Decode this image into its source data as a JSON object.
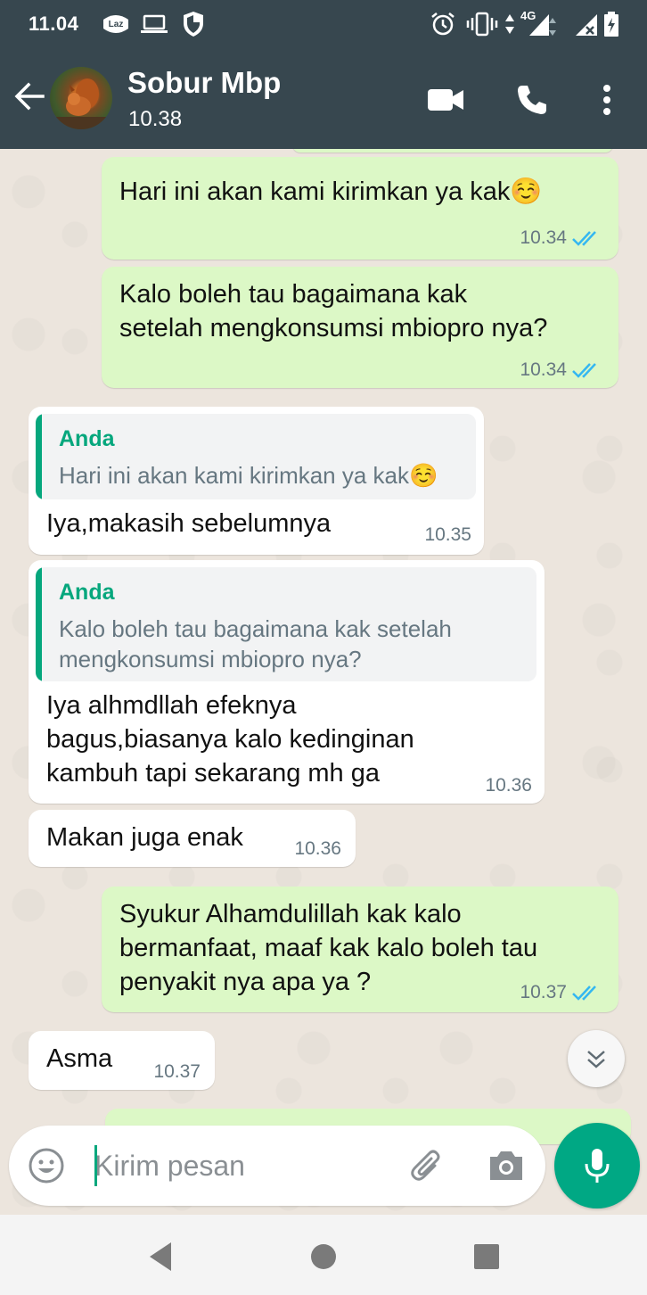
{
  "status_bar": {
    "time": "11.04",
    "app_badge": "Laz",
    "network": "4G",
    "icons": [
      "lazada-icon",
      "laptop-icon",
      "shield-icon",
      "alarm-icon",
      "vibrate-icon",
      "data-arrows-icon",
      "signal-icon",
      "signal-no-data-icon",
      "battery-charging-icon"
    ]
  },
  "header": {
    "contact_name": "Sobur Mbp",
    "subtitle": "10.38",
    "icons": [
      "back-arrow-icon",
      "avatar",
      "video-call-icon",
      "voice-call-icon",
      "more-options-icon"
    ]
  },
  "messages": [
    {
      "direction": "out",
      "text": "Hari ini akan kami kirimkan ya kak☺️",
      "time": "10.34",
      "status": "read"
    },
    {
      "direction": "out",
      "text": "Kalo boleh tau bagaimana kak setelah mengkonsumsi mbiopro nya?",
      "line1": "Kalo boleh tau bagaimana kak",
      "line2": "setelah mengkonsumsi mbiopro nya?",
      "time": "10.34",
      "status": "read"
    },
    {
      "direction": "in",
      "quote_name": "Anda",
      "quote_text": "Hari ini akan kami kirimkan ya kak☺️",
      "text": "Iya,makasih sebelumnya",
      "time": "10.35"
    },
    {
      "direction": "in",
      "quote_name": "Anda",
      "quote_line1": "Kalo boleh tau bagaimana kak setelah",
      "quote_line2": "mengkonsumsi mbiopro nya?",
      "line1": "Iya alhmdllah efeknya",
      "line2": "bagus,biasanya kalo kedinginan",
      "line3": "kambuh tapi sekarang mh ga",
      "time": "10.36"
    },
    {
      "direction": "in",
      "text": "Makan juga enak",
      "time": "10.36"
    },
    {
      "direction": "out",
      "line1": "Syukur Alhamdulillah kak kalo",
      "line2": "bermanfaat, maaf kak kalo boleh tau",
      "line3": "penyakit nya apa ya ?",
      "time": "10.37",
      "status": "read"
    },
    {
      "direction": "in",
      "text": "Asma",
      "time": "10.37"
    }
  ],
  "input": {
    "placeholder": "Kirim pesan",
    "value": ""
  },
  "colors": {
    "header": "#37474f",
    "outgoing_bubble": "#dcf8c6",
    "incoming_bubble": "#ffffff",
    "accent": "#00a884",
    "read_ticks": "#34b7f1"
  }
}
